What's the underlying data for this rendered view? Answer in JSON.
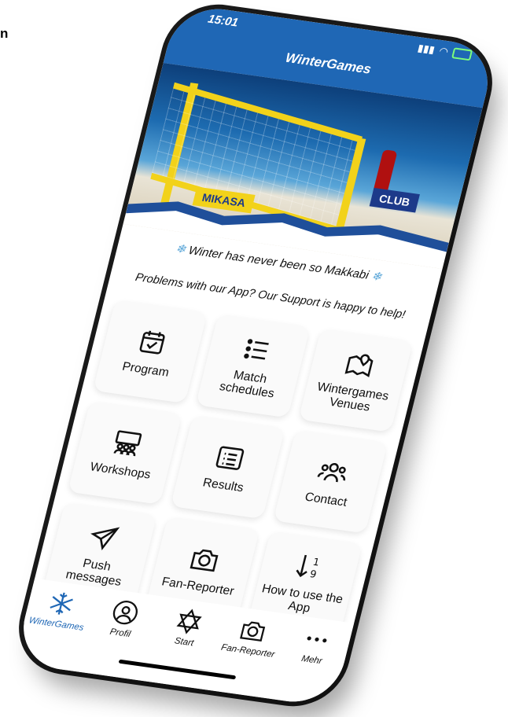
{
  "corner_text": "n",
  "status": {
    "time": "15:01"
  },
  "header": {
    "title": "WinterGames"
  },
  "hero": {
    "banner_left": "MIKASA",
    "banner_right": "CLUB"
  },
  "tagline": "Winter has never been so Makkabi",
  "support_text": "Problems with our App? Our Support is happy to help!",
  "tiles": [
    {
      "label": "Program",
      "icon": "calendar-check-icon"
    },
    {
      "label": "Match schedules",
      "icon": "list-icon"
    },
    {
      "label": "Wintergames Venues",
      "icon": "map-pin-icon"
    },
    {
      "label": "Workshops",
      "icon": "workshop-icon"
    },
    {
      "label": "Results",
      "icon": "document-list-icon"
    },
    {
      "label": "Contact",
      "icon": "people-icon"
    },
    {
      "label": "Push messages",
      "icon": "paper-plane-icon"
    },
    {
      "label": "Fan-Reporter",
      "icon": "camera-icon"
    },
    {
      "label": "How to use the App",
      "icon": "sort-icon"
    }
  ],
  "tabbar": [
    {
      "label": "WinterGames",
      "icon": "snowflake-icon",
      "active": true
    },
    {
      "label": "Profil",
      "icon": "user-icon",
      "active": false
    },
    {
      "label": "Start",
      "icon": "star-of-david-icon",
      "active": false
    },
    {
      "label": "Fan-Reporter",
      "icon": "camera-icon",
      "active": false
    },
    {
      "label": "Mehr",
      "icon": "more-icon",
      "active": false
    }
  ],
  "colors": {
    "primary": "#1f67b5",
    "tile_bg": "#fafafa"
  }
}
